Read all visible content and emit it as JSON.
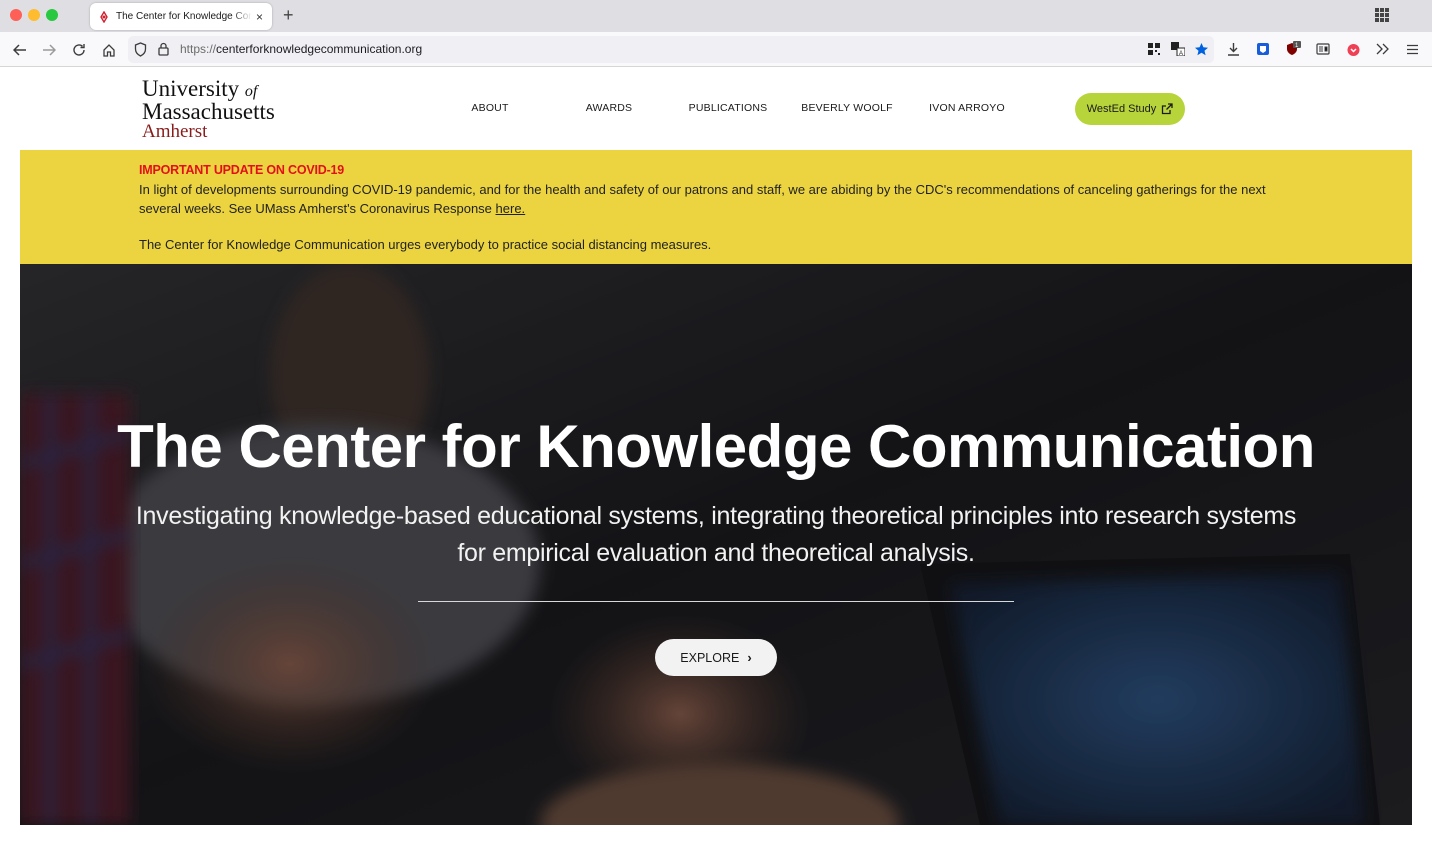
{
  "browser": {
    "tab_title": "The Center for Knowledge Communication",
    "tab_close": "×",
    "new_tab": "+",
    "url_protocol": "https://",
    "url_host": "centerforknowledgecommunication.org"
  },
  "header": {
    "logo": {
      "line1": "University",
      "line1_small": "of",
      "line2": "Massachusetts",
      "line3": "Amherst"
    },
    "nav": [
      {
        "label": "ABOUT"
      },
      {
        "label": "AWARDS"
      },
      {
        "label": "PUBLICATIONS"
      },
      {
        "label": "BEVERLY WOOLF"
      },
      {
        "label": "IVON ARROYO"
      }
    ],
    "cta_label": "WestEd Study"
  },
  "banner": {
    "title": "IMPORTANT UPDATE ON COVID-19",
    "text": "In light of developments surrounding COVID-19 pandemic, and for the health and safety of our patrons and staff, we are abiding by the CDC's recommendations of canceling gatherings for the next several weeks. See UMass Amherst's Coronavirus Response",
    "link_text": "here.",
    "text2": "The Center for Knowledge Communication urges everybody to practice social distancing measures."
  },
  "hero": {
    "title": "The Center for Knowledge Communication",
    "subtitle": "Investigating knowledge-based educational systems, integrating theoretical principles into research systems for empirical evaluation and theoretical analysis.",
    "button_label": "EXPLORE",
    "button_chevron": "›"
  },
  "colors": {
    "banner_bg": "#ecd440",
    "banner_title": "#e3101a",
    "cta_bg": "#b8d43b",
    "amherst_maroon": "#881c1c"
  }
}
